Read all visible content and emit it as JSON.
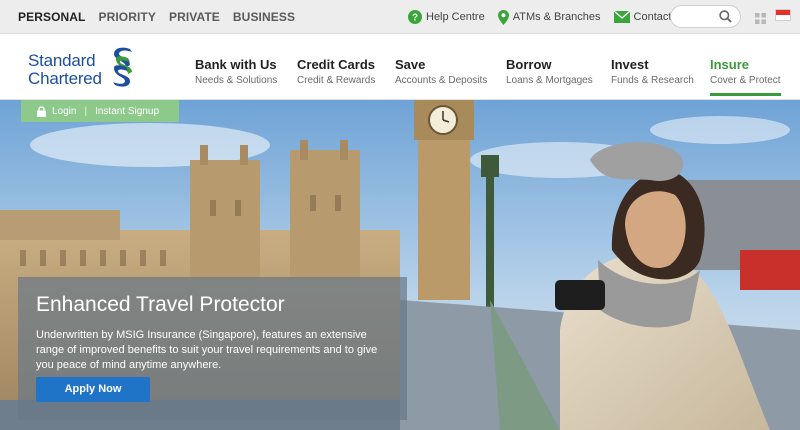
{
  "topbar": {
    "segments": [
      "PERSONAL",
      "PRIORITY",
      "PRIVATE",
      "BUSINESS"
    ],
    "active_segment": "PERSONAL",
    "utility_links": [
      {
        "label": "Help Centre",
        "icon": "help-icon"
      },
      {
        "label": "ATMs & Branches",
        "icon": "location-pin-icon"
      },
      {
        "label": "Contact Us",
        "icon": "mail-icon"
      }
    ],
    "search": {
      "placeholder": "",
      "icon": "search-icon"
    },
    "grid_icon": "grid-icon",
    "flag_icon": "singapore-flag-icon"
  },
  "brand": {
    "name_line1": "Standard",
    "name_line2": "Chartered",
    "colors": {
      "blue": "#1c4fa0",
      "green": "#3a9b3a"
    }
  },
  "nav": {
    "items": [
      {
        "title": "Bank with Us",
        "subtitle": "Needs & Solutions"
      },
      {
        "title": "Credit Cards",
        "subtitle": "Credit & Rewards"
      },
      {
        "title": "Save",
        "subtitle": "Accounts & Deposits"
      },
      {
        "title": "Borrow",
        "subtitle": "Loans & Mortgages"
      },
      {
        "title": "Invest",
        "subtitle": "Funds & Research"
      },
      {
        "title": "Insure",
        "subtitle": "Cover & Protect"
      }
    ],
    "active_item": "Insure"
  },
  "login_bar": {
    "login": "Login",
    "signup": "Instant Signup",
    "icon": "lock-icon"
  },
  "promo": {
    "title": "Enhanced Travel Protector",
    "description": "Underwritten by MSIG Insurance (Singapore), features an extensive range of improved benefits to suit your travel requirements and to give you peace of mind anytime anywhere.",
    "cta": "Apply Now"
  }
}
